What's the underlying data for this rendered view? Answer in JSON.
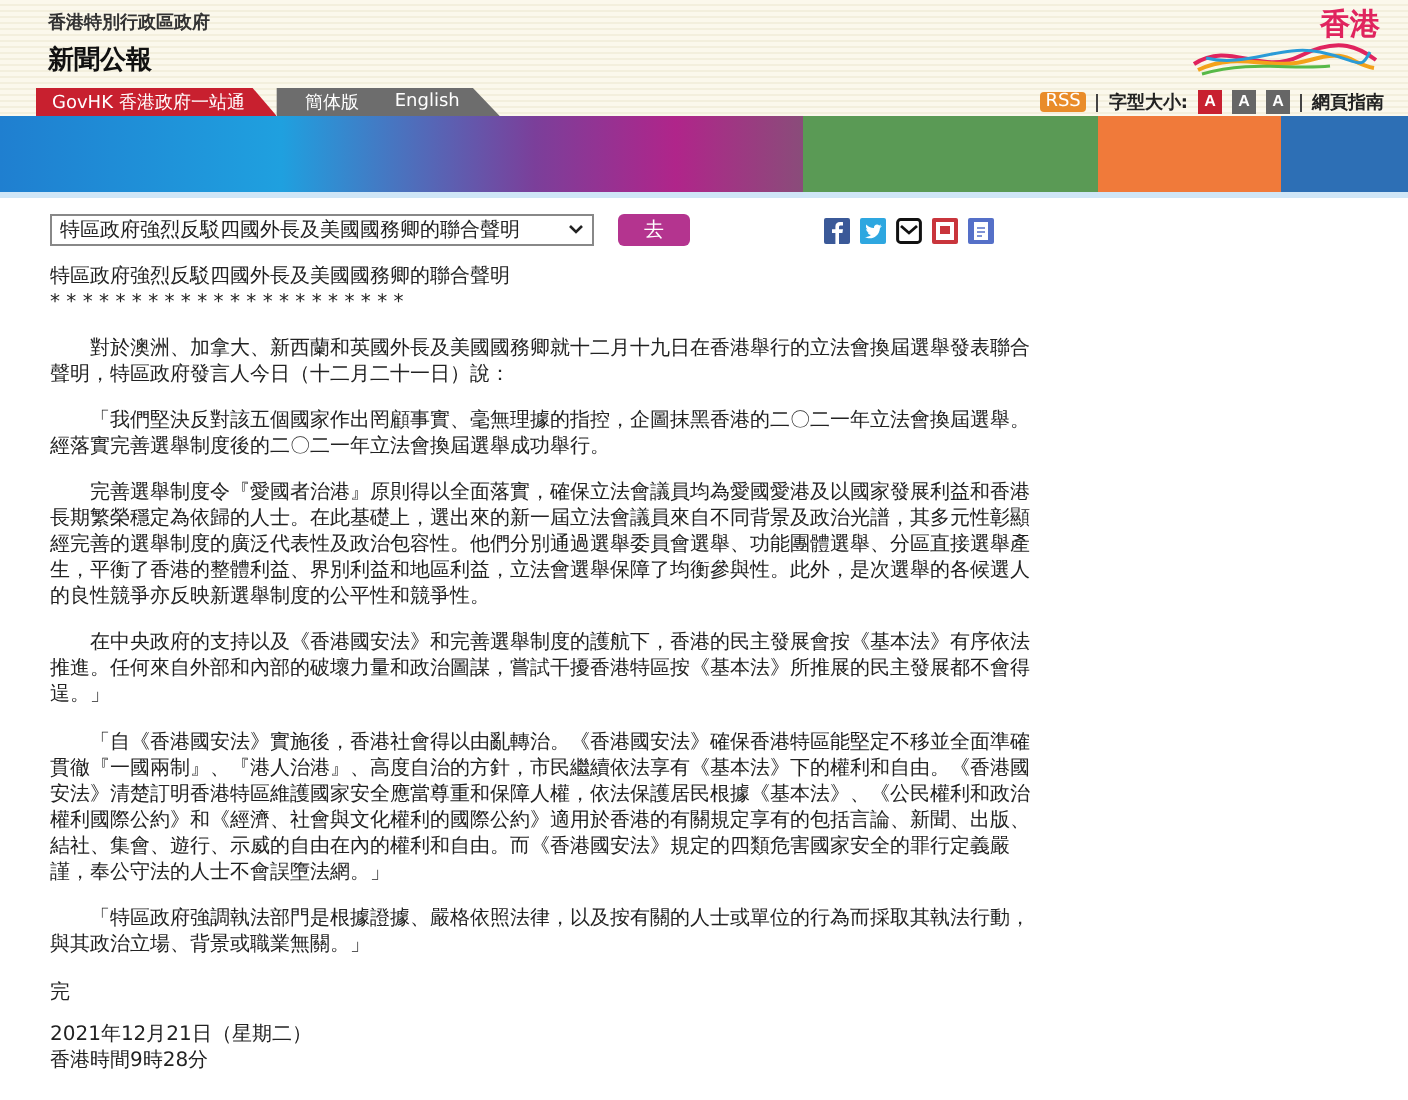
{
  "header": {
    "agency": "香港特別行政區政府",
    "title": "新聞公報",
    "logo_text": "香港"
  },
  "nav": {
    "links": [
      {
        "label": "GovHK 香港政府一站通",
        "kind": "portal"
      },
      {
        "label": "簡体版",
        "kind": "lang"
      },
      {
        "label": "English",
        "kind": "lang"
      }
    ]
  },
  "tools": {
    "rss": "RSS",
    "font_size_label": "字型大小:",
    "font_sizes": [
      {
        "label": "A",
        "selected": true
      },
      {
        "label": "A",
        "selected": false
      },
      {
        "label": "A",
        "selected": false
      }
    ],
    "guide": "網頁指南"
  },
  "selector": {
    "value": "特區政府強烈反駁四國外長及美國國務卿的聯合聲明",
    "go": "去"
  },
  "article": {
    "title": "特區政府強烈反駁四國外長及美國國務卿的聯合聲明",
    "stars": "* * * * * * * * * * * * * * * * * * * * * *",
    "paragraphs": [
      "對於澳洲、加拿大、新西蘭和英國外長及美國國務卿就十二月十九日在香港舉行的立法會換屆選舉發表聯合聲明，特區政府發言人今日（十二月二十一日）說：",
      "「我們堅決反對該五個國家作出罔顧事實、毫無理據的指控，企圖抹黑香港的二〇二一年立法會換屆選舉。經落實完善選舉制度後的二〇二一年立法會換屆選舉成功舉行。",
      "完善選舉制度令『愛國者治港』原則得以全面落實，確保立法會議員均為愛國愛港及以國家發展利益和香港長期繁榮穩定為依歸的人士。在此基礎上，選出來的新一屆立法會議員來自不同背景及政治光譜，其多元性彰顯經完善的選舉制度的廣泛代表性及政治包容性。他們分別通過選舉委員會選舉、功能團體選舉、分區直接選舉產生，平衡了香港的整體利益、界別利益和地區利益，立法會選舉保障了均衡參與性。此外，是次選舉的各候選人的良性競爭亦反映新選舉制度的公平性和競爭性。",
      "在中央政府的支持以及《香港國安法》和完善選舉制度的護航下，香港的民主發展會按《基本法》有序依法推進。任何來自外部和內部的破壞力量和政治圖謀，嘗試干擾香港特區按《基本法》所推展的民主發展都不會得逞。」",
      "「自《香港國安法》實施後，香港社會得以由亂轉治。《香港國安法》確保香港特區能堅定不移並全面準確貫徹『一國兩制』、『港人治港』、高度自治的方針，市民繼續依法享有《基本法》下的權利和自由。《香港國安法》清楚訂明香港特區維護國家安全應當尊重和保障人權，依法保護居民根據《基本法》、《公民權利和政治權利國際公約》和《經濟、社會與文化權利的國際公約》適用於香港的有關規定享有的包括言論、新聞、出版、結社、集會、遊行、示威的自由在內的權利和自由。而《香港國安法》規定的四類危害國家安全的罪行定義嚴謹，奉公守法的人士不會誤墮法網。」",
      "「特區政府強調執法部門是根據證據、嚴格依照法律，以及按有關的人士或單位的行為而採取其執法行動，與其政治立場、背景或職業無關。」"
    ],
    "end": "完",
    "date": "2021年12月21日（星期二）",
    "time": "香港時間9時28分"
  }
}
